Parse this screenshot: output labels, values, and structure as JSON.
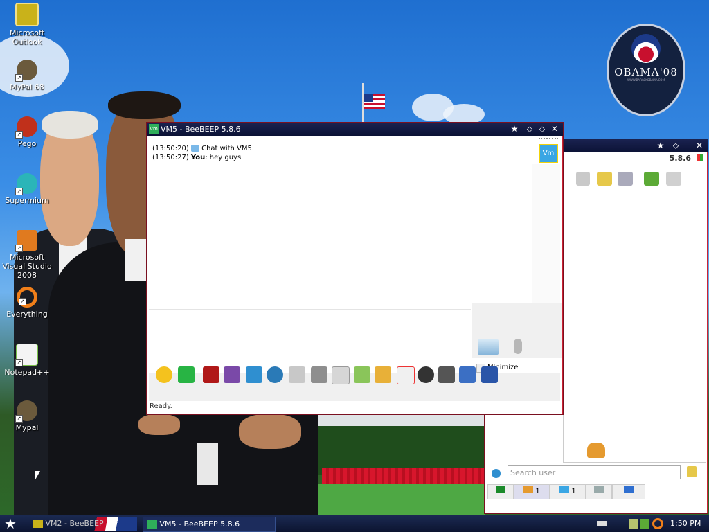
{
  "desktop": {
    "icons": [
      {
        "label": "Microsoft Outlook",
        "name": "outlook-icon",
        "color": "#c9b21a"
      },
      {
        "label": "MyPal 68",
        "name": "mypal-icon",
        "color": "#6b5a3c"
      },
      {
        "label": "Pego",
        "name": "pego-icon",
        "color": "#c0301b"
      },
      {
        "label": "Supermium",
        "name": "supermium-icon",
        "color": "#2bb5b8"
      },
      {
        "label": "Microsoft Visual Studio 2008",
        "name": "visual-studio-icon",
        "color": "#e07a1f"
      },
      {
        "label": "Everything",
        "name": "everything-icon",
        "color": "#f07f1a"
      },
      {
        "label": "Notepad++",
        "name": "notepadpp-icon",
        "color": "#7ac04a"
      },
      {
        "label": "Mypal",
        "name": "mypal-icon",
        "color": "#6b5a3c"
      }
    ],
    "badge": {
      "title": "OBAMA'08",
      "sub": "WWW.BARACKOBAMA.COM"
    }
  },
  "chat_window": {
    "title": "VM5 - BeeBEEP 5.8.6",
    "app_icon_text": "Vm",
    "avatar_text": "Vm",
    "messages": [
      {
        "time": "(13:50:20)",
        "sender": "",
        "text": "Chat with VM5."
      },
      {
        "time": "(13:50:27)",
        "sender": "You",
        "text": ": hey guys"
      }
    ],
    "minimize_label": "Minimize",
    "status": "Ready.",
    "toolbar_icons": [
      "emoticon-icon",
      "color-icon",
      "font-icon",
      "text-style-icon",
      "filter-icon",
      "settings-icon",
      "spellcheck-icon",
      "dictionary-icon",
      "sound-icon",
      "send-file-icon",
      "send-folder-icon",
      "code-icon",
      "screenshot-icon",
      "clear-icon",
      "edit-icon",
      "save-icon"
    ]
  },
  "main_window": {
    "version": "5.8.6",
    "search_placeholder": "Search user",
    "tabs": [
      {
        "name": "users-tab",
        "count": "1"
      },
      {
        "name": "chats-tab",
        "count": "1"
      },
      {
        "name": "groups-tab",
        "count": ""
      },
      {
        "name": "files-tab",
        "count": ""
      }
    ]
  },
  "taskbar": {
    "items": [
      "VM2 - BeeBEEP",
      "VM5 - BeeBEEP 5.8.6"
    ],
    "clock": "1:50 PM"
  }
}
